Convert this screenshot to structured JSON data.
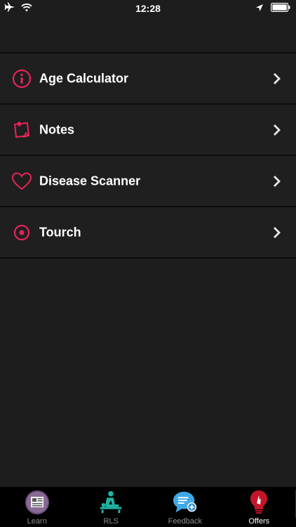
{
  "status_bar": {
    "time": "12:28",
    "left_icons": [
      "airplane-icon",
      "wifi-icon"
    ],
    "right_icons": [
      "location-arrow-icon",
      "battery-icon"
    ]
  },
  "menu": {
    "items": [
      {
        "label": "Age Calculator",
        "icon": "info-circle-icon"
      },
      {
        "label": "Notes",
        "icon": "notes-icon"
      },
      {
        "label": "Disease Scanner",
        "icon": "heart-icon"
      },
      {
        "label": "Tourch",
        "icon": "target-circle-icon"
      }
    ]
  },
  "tab_bar": {
    "tabs": [
      {
        "label": "Learn",
        "icon": "newspaper-icon"
      },
      {
        "label": "RLS",
        "icon": "cpr-icon"
      },
      {
        "label": "Feedback",
        "icon": "chat-plus-icon"
      },
      {
        "label": "Offers",
        "icon": "lightbulb-icon"
      }
    ],
    "active": "Offers"
  },
  "colors": {
    "accent": "#e8245a",
    "background": "#1d1d1d",
    "tab_bar": "#000000",
    "teal": "#1fb5a6"
  }
}
